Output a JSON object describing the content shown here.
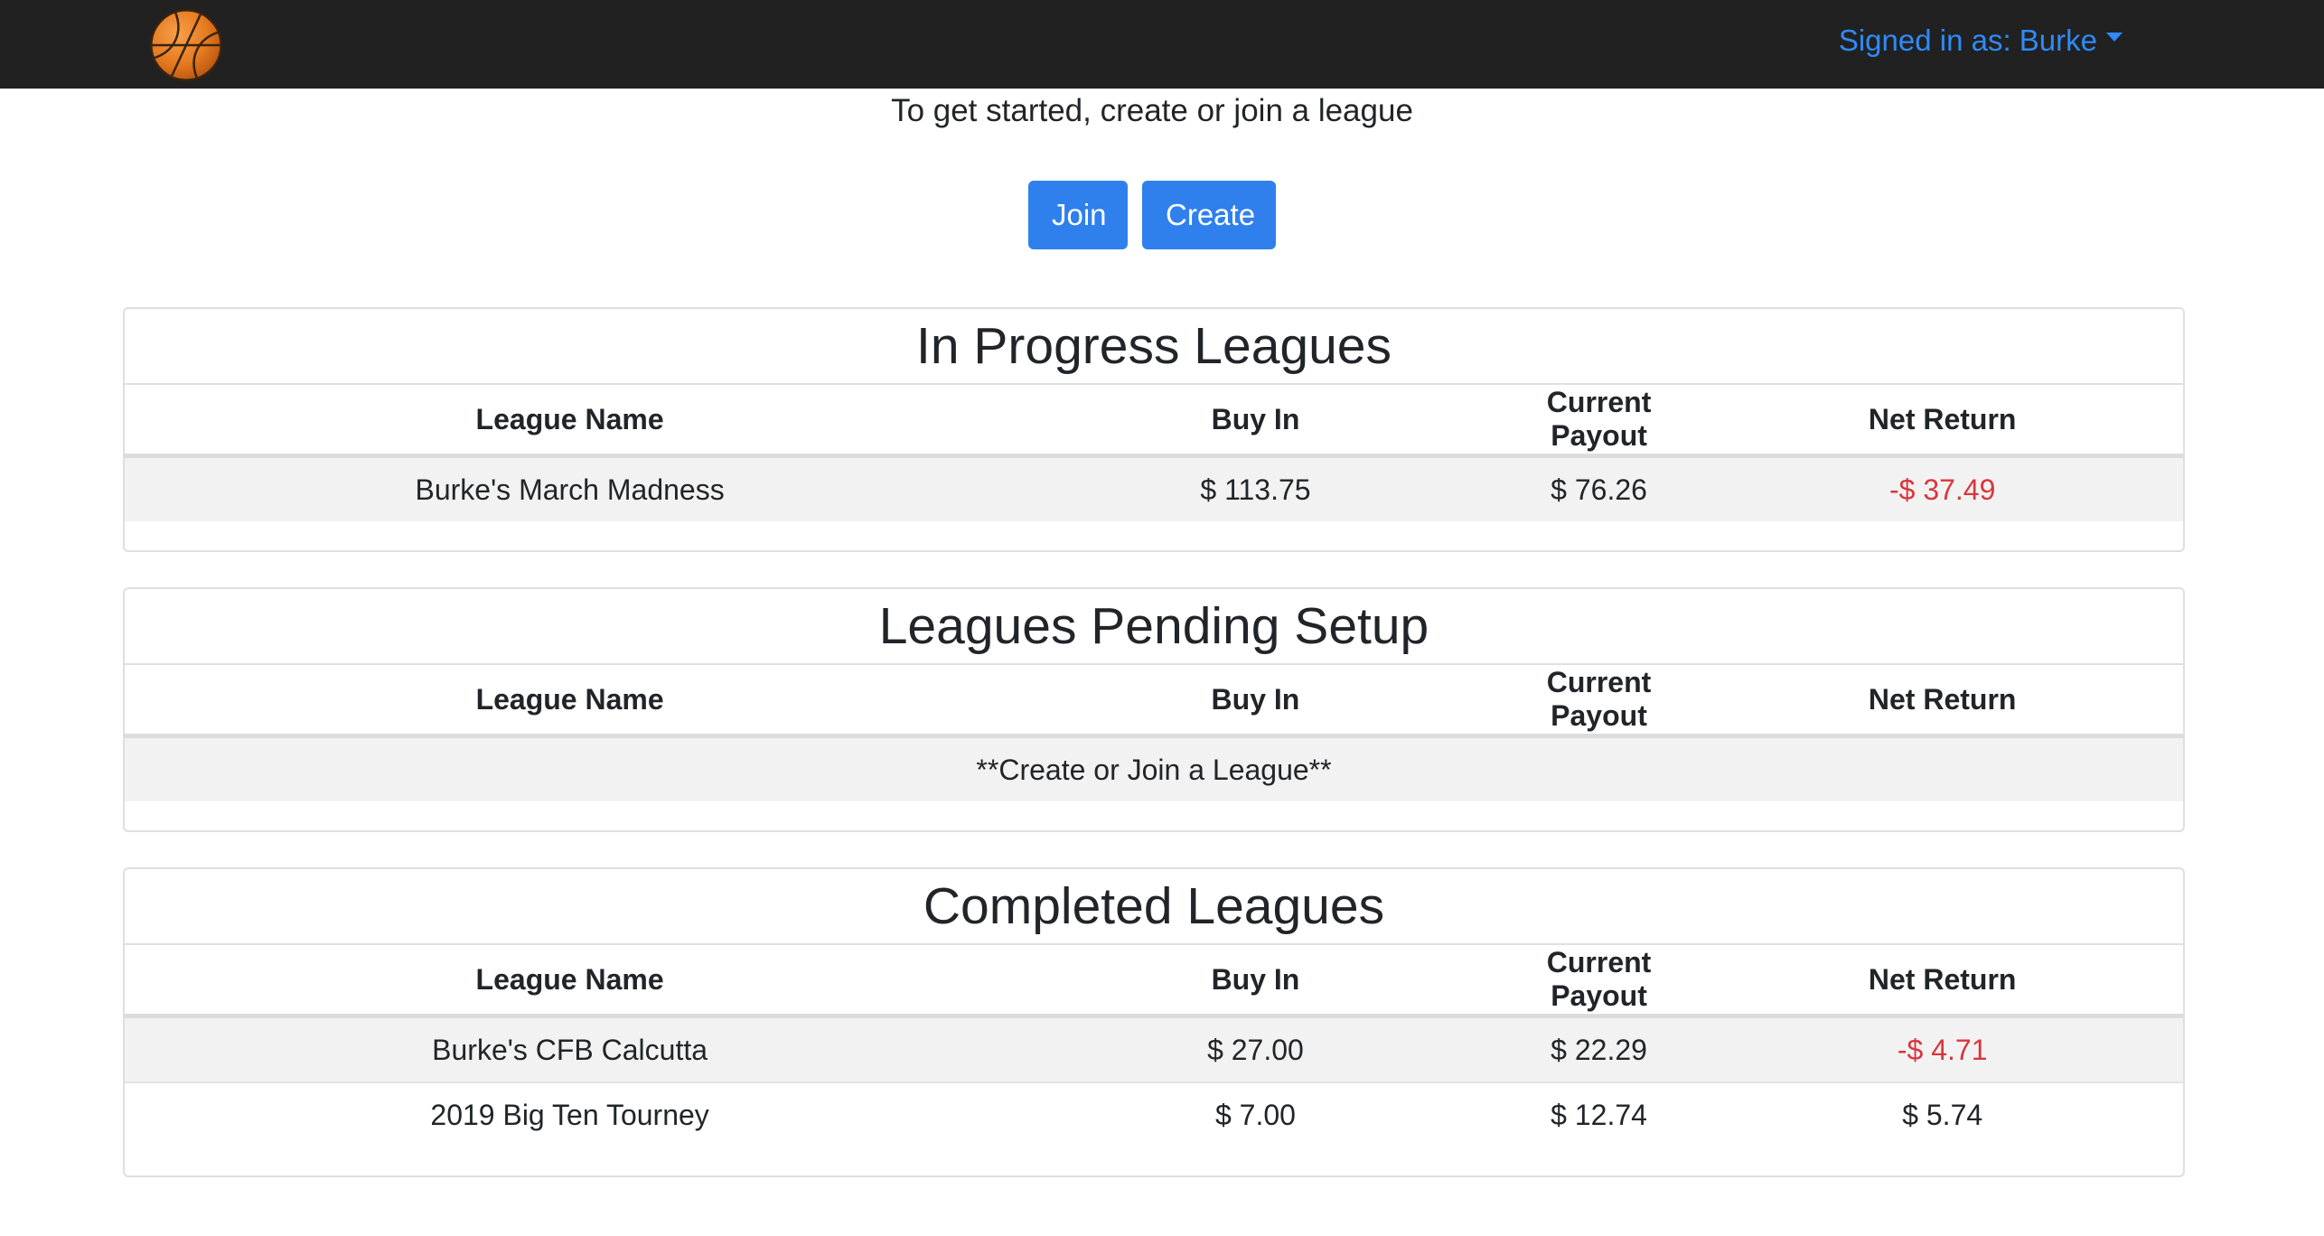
{
  "nav": {
    "user_label": "Signed in as: Burke",
    "logo_icon": "basketball-icon"
  },
  "intro": {
    "text": "To get started, create or join a league"
  },
  "actions": {
    "join_label": "Join",
    "create_label": "Create"
  },
  "columns": {
    "name": "League Name",
    "buy_in": "Buy In",
    "payout": "Current Payout",
    "net": "Net Return"
  },
  "in_progress": {
    "title": "In Progress Leagues",
    "rows": [
      {
        "name": "Burke's March Madness",
        "buy_in": "$ 113.75",
        "payout": "$ 76.26",
        "net": "-$ 37.49"
      }
    ]
  },
  "pending": {
    "title": "Leagues Pending Setup",
    "empty_text": "**Create or Join a League**"
  },
  "completed": {
    "title": "Completed Leagues",
    "rows": [
      {
        "name": "Burke's CFB Calcutta",
        "buy_in": "$ 27.00",
        "payout": "$ 22.29",
        "net": "-$ 4.71"
      },
      {
        "name": "2019 Big Ten Tourney",
        "buy_in": "$ 7.00",
        "payout": "$ 12.74",
        "net": "$ 5.74"
      }
    ]
  },
  "colors": {
    "nav_bg": "#212121",
    "link": "#2f8bf7",
    "button": "#2f80ed",
    "negative": "#d9363e"
  }
}
